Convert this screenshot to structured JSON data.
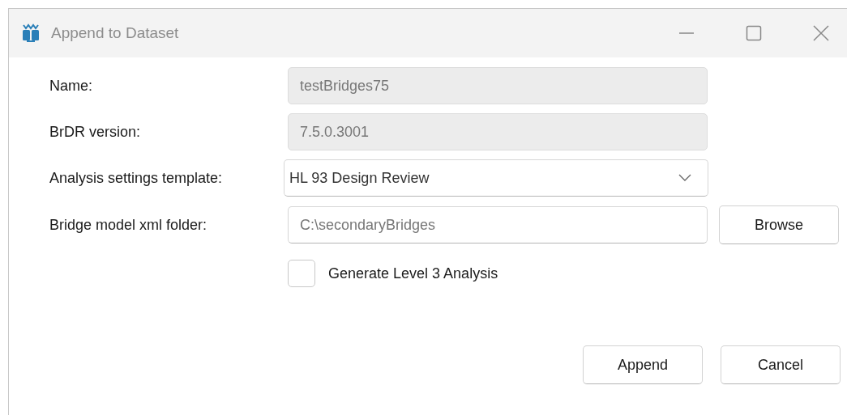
{
  "window": {
    "title": "Append to Dataset"
  },
  "fields": [
    {
      "label": "Name:",
      "value": "testBridges75",
      "kind": "text",
      "disabled": true
    },
    {
      "label": "BrDR version:",
      "value": "7.5.0.3001",
      "kind": "text",
      "disabled": true
    },
    {
      "label": "Analysis settings template:",
      "value": "HL 93 Design Review",
      "kind": "dropdown",
      "disabled": false
    },
    {
      "label": "Bridge model xml folder:",
      "value": "C:\\secondaryBridges",
      "kind": "folder",
      "disabled": false,
      "button": "Browse"
    }
  ],
  "checkbox": {
    "label": "Generate Level 3 Analysis",
    "checked": false
  },
  "buttons": [
    "Append",
    "Cancel"
  ]
}
